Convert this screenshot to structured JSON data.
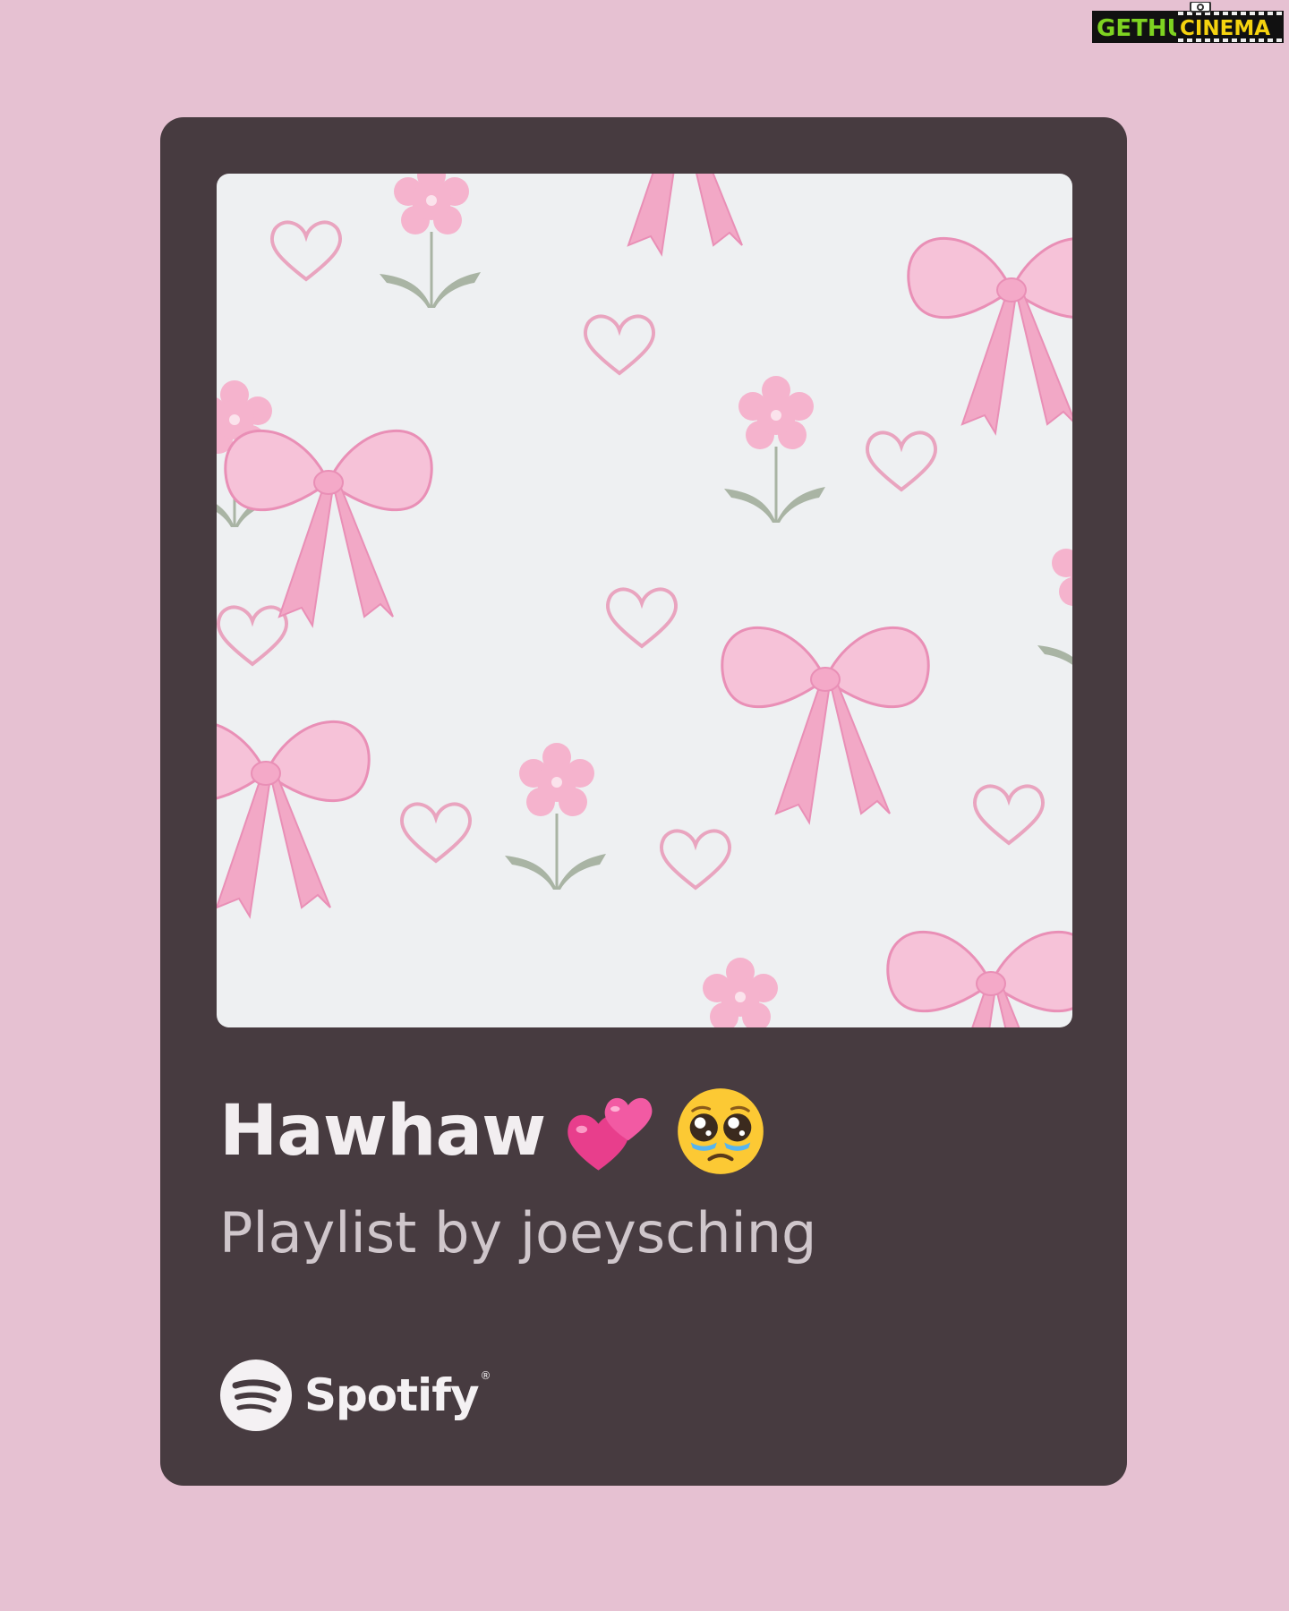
{
  "watermark": {
    "part1": "GETHU",
    "part2": "CINEMA"
  },
  "playlist": {
    "title": "Hawhaw",
    "title_emojis": [
      "two-hearts-emoji",
      "pleading-face-emoji"
    ],
    "subtitle": "Playlist by joeysching",
    "cover_art": "pink-bows-flowers-hearts-pattern"
  },
  "brand": {
    "name": "Spotify",
    "logo_icon": "spotify-logo-icon"
  },
  "colors": {
    "background": "#e6c1d2",
    "card": "#473b40",
    "cover_background": "#eef0f2",
    "pink": "#f2a8c6",
    "leaf_green": "#a9b4a4",
    "title_text": "#f2eef0",
    "subtitle_text": "#cfc6cb",
    "watermark_green": "#7ed321",
    "watermark_yellow": "#f5d30f"
  }
}
